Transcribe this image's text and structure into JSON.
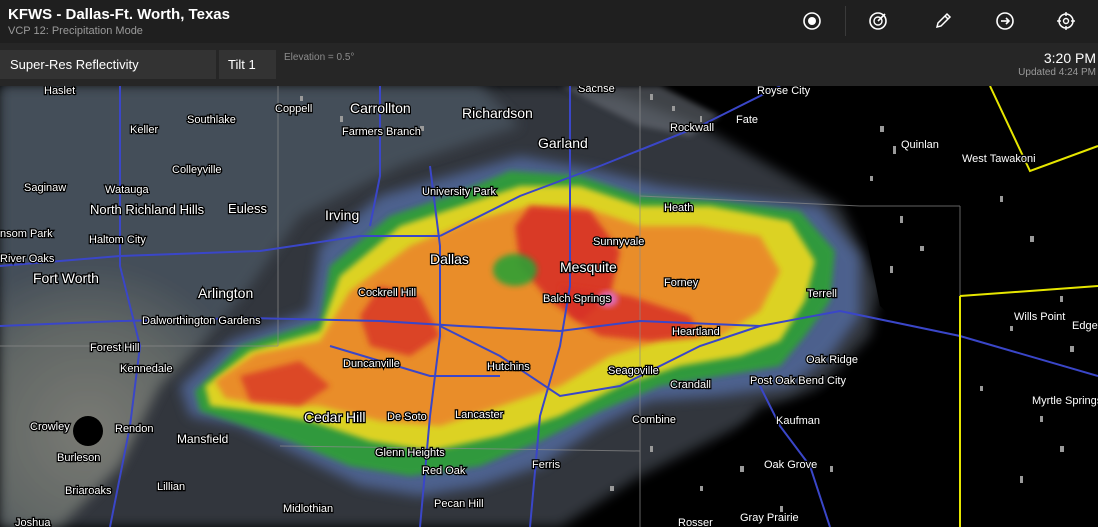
{
  "header": {
    "title": "KFWS - Dallas-Ft. Worth, Texas",
    "subtitle": "VCP 12: Precipitation Mode",
    "toolbar": [
      {
        "icon": "record-icon"
      },
      {
        "icon": "radar-sweep-icon"
      },
      {
        "icon": "pencil-icon"
      },
      {
        "icon": "circle-arrow-icon"
      },
      {
        "icon": "crosshair-icon"
      }
    ]
  },
  "controls": {
    "product": "Super-Res Reflectivity",
    "tilt": "Tilt 1",
    "elevation": "Elevation = 0.5°",
    "time": "3:20 PM",
    "updated": "Updated 4:24 PM"
  },
  "colors": {
    "topbar": "#1f1f1f",
    "controlbar": "#262626",
    "roads": "#3a46c8",
    "county_lines": "#8c8c8c",
    "warning_polygon": "#e6e600",
    "radar_gray": "#8a8a7a",
    "radar_green": "#1e9e2e",
    "radar_yellow": "#e8d824",
    "radar_orange": "#ea8a2a",
    "radar_red": "#d42828",
    "radar_pink": "#e070c0"
  },
  "map": {
    "radar_site": "KFWS",
    "cities": [
      {
        "name": "Haslet",
        "size": "small"
      },
      {
        "name": "Coppell",
        "size": "small"
      },
      {
        "name": "Carrollton",
        "size": "large"
      },
      {
        "name": "Richardson",
        "size": "large"
      },
      {
        "name": "Sachse",
        "size": "small"
      },
      {
        "name": "Royse City",
        "size": "small"
      },
      {
        "name": "Southlake",
        "size": "small"
      },
      {
        "name": "Keller",
        "size": "small"
      },
      {
        "name": "Farmers Branch",
        "size": "small"
      },
      {
        "name": "Rockwall",
        "size": "small"
      },
      {
        "name": "Fate",
        "size": "small"
      },
      {
        "name": "Quinlan",
        "size": "small"
      },
      {
        "name": "Garland",
        "size": "large"
      },
      {
        "name": "Colleyville",
        "size": "small"
      },
      {
        "name": "Saginaw",
        "size": "small"
      },
      {
        "name": "Watauga",
        "size": "small"
      },
      {
        "name": "University Park",
        "size": "small"
      },
      {
        "name": "West Tawakoni",
        "size": "small"
      },
      {
        "name": "North Richland Hills",
        "size": "large"
      },
      {
        "name": "Euless",
        "size": "large"
      },
      {
        "name": "Irving",
        "size": "large"
      },
      {
        "name": "Heath",
        "size": "small"
      },
      {
        "name": "Haltom City",
        "size": "small"
      },
      {
        "name": "nsom Park",
        "size": "small"
      },
      {
        "name": "Sunnyvale",
        "size": "small"
      },
      {
        "name": "Dallas",
        "size": "large"
      },
      {
        "name": "River Oaks",
        "size": "small"
      },
      {
        "name": "Mesquite",
        "size": "large"
      },
      {
        "name": "Fort Worth",
        "size": "large"
      },
      {
        "name": "Forney",
        "size": "small"
      },
      {
        "name": "Arlington",
        "size": "large"
      },
      {
        "name": "Cockrell Hill",
        "size": "small"
      },
      {
        "name": "Balch Springs",
        "size": "small"
      },
      {
        "name": "Terrell",
        "size": "small"
      },
      {
        "name": "Dalworthington Gardens",
        "size": "small"
      },
      {
        "name": "Wills Point",
        "size": "small"
      },
      {
        "name": "Edgev",
        "size": "small"
      },
      {
        "name": "Heartland",
        "size": "small"
      },
      {
        "name": "Forest Hill",
        "size": "small"
      },
      {
        "name": "Duncanville",
        "size": "small"
      },
      {
        "name": "Kennedale",
        "size": "small"
      },
      {
        "name": "Hutchins",
        "size": "small"
      },
      {
        "name": "Seagoville",
        "size": "small"
      },
      {
        "name": "Oak Ridge",
        "size": "small"
      },
      {
        "name": "Crandall",
        "size": "small"
      },
      {
        "name": "Post Oak Bend City",
        "size": "small"
      },
      {
        "name": "Myrtle Springs",
        "size": "small"
      },
      {
        "name": "Cedar Hill",
        "size": "large"
      },
      {
        "name": "De Soto",
        "size": "small"
      },
      {
        "name": "Lancaster",
        "size": "small"
      },
      {
        "name": "Combine",
        "size": "small"
      },
      {
        "name": "Kaufman",
        "size": "small"
      },
      {
        "name": "Crowley",
        "size": "small"
      },
      {
        "name": "Rendon",
        "size": "small"
      },
      {
        "name": "Mansfield",
        "size": "large"
      },
      {
        "name": "Glenn Heights",
        "size": "small"
      },
      {
        "name": "Burleson",
        "size": "small"
      },
      {
        "name": "Oak Grove",
        "size": "small"
      },
      {
        "name": "Red Oak",
        "size": "small"
      },
      {
        "name": "Ferris",
        "size": "small"
      },
      {
        "name": "Briaroaks",
        "size": "small"
      },
      {
        "name": "Lillian",
        "size": "small"
      },
      {
        "name": "Pecan Hill",
        "size": "small"
      },
      {
        "name": "Midlothian",
        "size": "small"
      },
      {
        "name": "Gray Prairie",
        "size": "small"
      },
      {
        "name": "Rosser",
        "size": "small"
      },
      {
        "name": "Joshua",
        "size": "small"
      }
    ]
  }
}
